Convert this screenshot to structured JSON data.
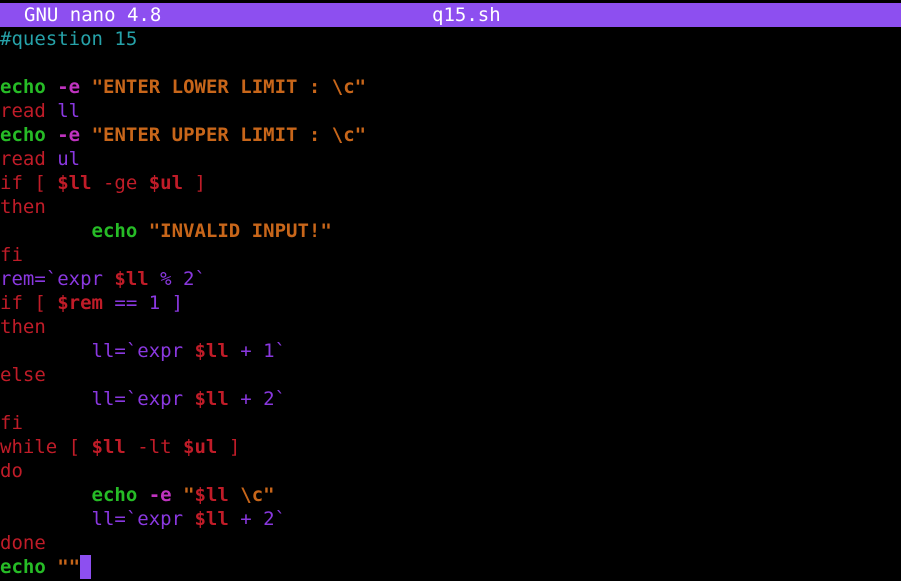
{
  "window": {
    "app_name": "GNU nano 4.8",
    "file_name": "q15.sh",
    "title_bar_color": "#8d4ff0",
    "background_color": "#000000"
  },
  "syntax_colors": {
    "comment": "#26a2a9",
    "builtin": "#26bc26",
    "flag": "#c033c0",
    "string": "#c8661a",
    "keyword": "#c01c28",
    "variable": "#c01c28",
    "identifier": "#8a38e0",
    "operator": "#8a38e0",
    "default": "#d0cfcc"
  },
  "editor": {
    "lines": [
      [
        {
          "t": "#question 15",
          "c": "comment"
        }
      ],
      [],
      [
        {
          "t": "echo",
          "c": "builtin",
          "b": true
        },
        {
          "t": " "
        },
        {
          "t": "-e",
          "c": "flag",
          "b": true
        },
        {
          "t": " "
        },
        {
          "t": "\"ENTER LOWER LIMIT : \\c\"",
          "c": "string",
          "b": true
        }
      ],
      [
        {
          "t": "read",
          "c": "keyword"
        },
        {
          "t": " "
        },
        {
          "t": "ll",
          "c": "identifier"
        }
      ],
      [
        {
          "t": "echo",
          "c": "builtin",
          "b": true
        },
        {
          "t": " "
        },
        {
          "t": "-e",
          "c": "flag",
          "b": true
        },
        {
          "t": " "
        },
        {
          "t": "\"ENTER UPPER LIMIT : \\c\"",
          "c": "string",
          "b": true
        }
      ],
      [
        {
          "t": "read",
          "c": "keyword"
        },
        {
          "t": " "
        },
        {
          "t": "ul",
          "c": "identifier"
        }
      ],
      [
        {
          "t": "if [ ",
          "c": "keyword"
        },
        {
          "t": "$ll",
          "c": "variable",
          "b": true
        },
        {
          "t": " -ge ",
          "c": "keyword"
        },
        {
          "t": "$ul",
          "c": "variable",
          "b": true
        },
        {
          "t": " ]",
          "c": "keyword"
        }
      ],
      [
        {
          "t": "then",
          "c": "keyword"
        }
      ],
      [
        {
          "t": "        "
        },
        {
          "t": "echo",
          "c": "builtin",
          "b": true
        },
        {
          "t": " "
        },
        {
          "t": "\"INVALID INPUT!\"",
          "c": "string",
          "b": true
        }
      ],
      [
        {
          "t": "fi",
          "c": "keyword"
        }
      ],
      [
        {
          "t": "rem=`expr ",
          "c": "identifier"
        },
        {
          "t": "$ll",
          "c": "variable",
          "b": true
        },
        {
          "t": " % 2`",
          "c": "identifier"
        }
      ],
      [
        {
          "t": "if [ ",
          "c": "keyword"
        },
        {
          "t": "$rem",
          "c": "variable",
          "b": true
        },
        {
          "t": " == 1 ]",
          "c": "identifier"
        }
      ],
      [
        {
          "t": "then",
          "c": "keyword"
        }
      ],
      [
        {
          "t": "        "
        },
        {
          "t": "ll=`expr ",
          "c": "identifier"
        },
        {
          "t": "$ll",
          "c": "variable",
          "b": true
        },
        {
          "t": " + 1`",
          "c": "identifier"
        }
      ],
      [
        {
          "t": "else",
          "c": "keyword"
        }
      ],
      [
        {
          "t": "        "
        },
        {
          "t": "ll=`expr ",
          "c": "identifier"
        },
        {
          "t": "$ll",
          "c": "variable",
          "b": true
        },
        {
          "t": " + 2`",
          "c": "identifier"
        }
      ],
      [
        {
          "t": "fi",
          "c": "keyword"
        }
      ],
      [
        {
          "t": "while [ ",
          "c": "keyword"
        },
        {
          "t": "$ll",
          "c": "variable",
          "b": true
        },
        {
          "t": " -lt ",
          "c": "keyword"
        },
        {
          "t": "$ul",
          "c": "variable",
          "b": true
        },
        {
          "t": " ]",
          "c": "keyword"
        }
      ],
      [
        {
          "t": "do",
          "c": "keyword"
        }
      ],
      [
        {
          "t": "        "
        },
        {
          "t": "echo",
          "c": "builtin",
          "b": true
        },
        {
          "t": " "
        },
        {
          "t": "-e",
          "c": "flag",
          "b": true
        },
        {
          "t": " "
        },
        {
          "t": "\"",
          "c": "string",
          "b": true
        },
        {
          "t": "$ll",
          "c": "variable",
          "b": true
        },
        {
          "t": " \\c\"",
          "c": "string",
          "b": true
        }
      ],
      [
        {
          "t": "        "
        },
        {
          "t": "ll=`expr ",
          "c": "identifier"
        },
        {
          "t": "$ll",
          "c": "variable",
          "b": true
        },
        {
          "t": " + 2`",
          "c": "identifier"
        }
      ],
      [
        {
          "t": "done",
          "c": "keyword"
        }
      ],
      [
        {
          "t": "echo",
          "c": "builtin",
          "b": true
        },
        {
          "t": " "
        },
        {
          "t": "\"\"",
          "c": "string",
          "b": true
        }
      ]
    ],
    "cursor_line": 22
  }
}
